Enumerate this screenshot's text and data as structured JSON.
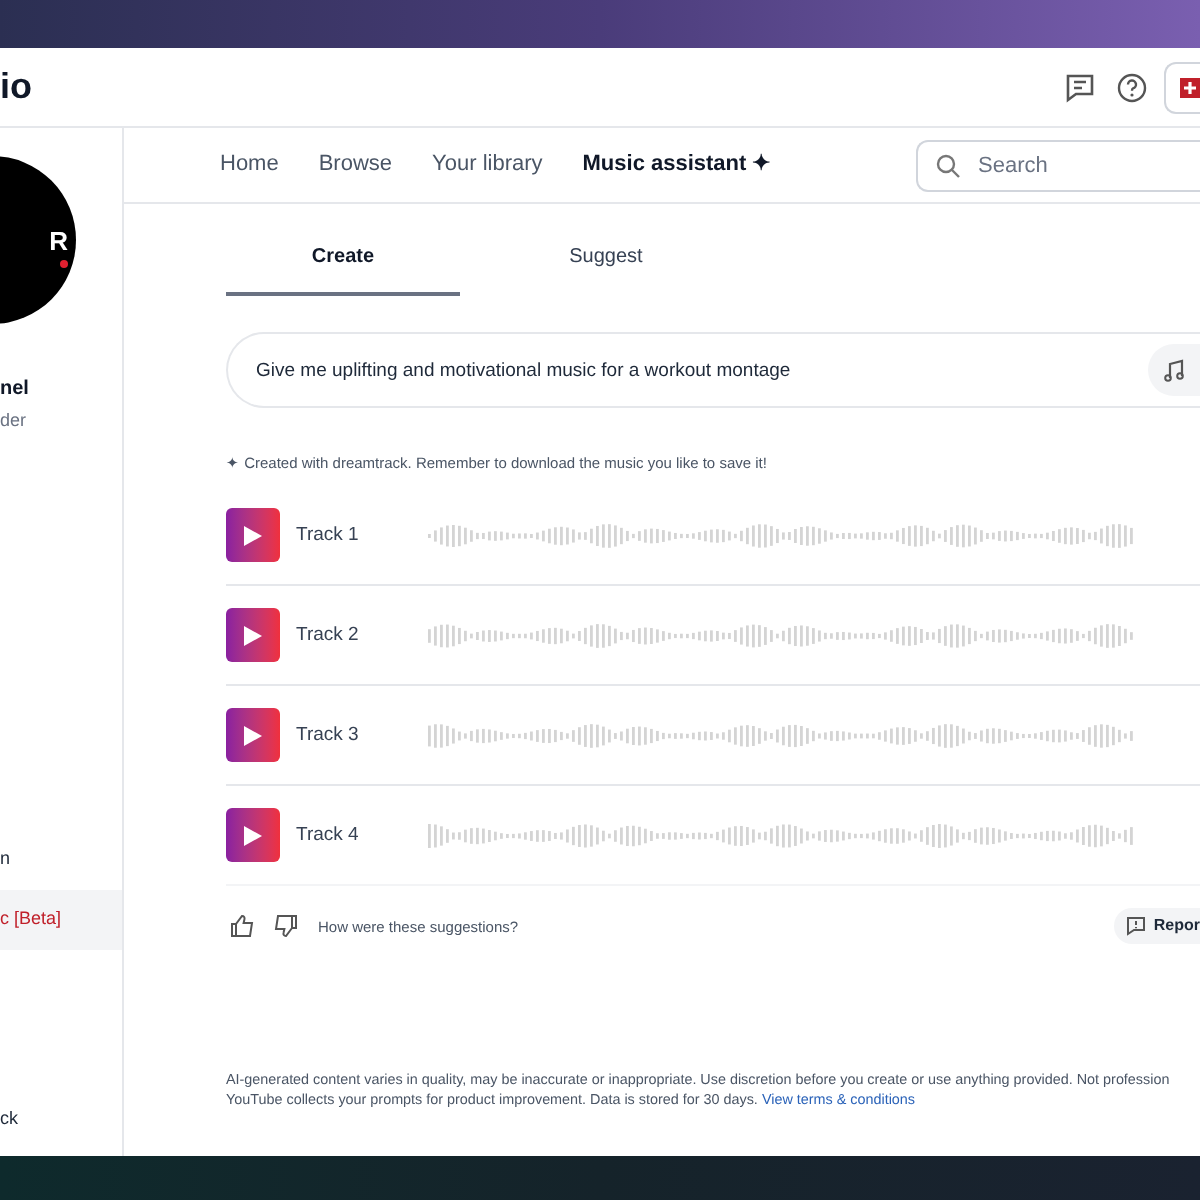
{
  "header": {
    "logo_text": "io"
  },
  "channel": {
    "avatar_text": "R",
    "name": "nel",
    "role": "der"
  },
  "sidebar": {
    "items": [
      {
        "label": "n",
        "selected": false
      },
      {
        "label": "c [Beta]",
        "selected": true
      }
    ],
    "footer": "ck"
  },
  "nav": {
    "tabs": [
      {
        "label": "Home",
        "selected": false
      },
      {
        "label": "Browse",
        "selected": false
      },
      {
        "label": "Your library",
        "selected": false
      },
      {
        "label": "Music assistant ✦",
        "selected": true
      }
    ],
    "search": {
      "placeholder": "Search"
    }
  },
  "mode_tabs": [
    {
      "label": "Create",
      "selected": true
    },
    {
      "label": "Suggest",
      "selected": false
    }
  ],
  "prompt": {
    "value": "Give me uplifting and motivational music for a workout montage"
  },
  "note": "✦ Created with dreamtrack. Remember to download the music you like to save it!",
  "tracks": [
    {
      "title": "Track 1"
    },
    {
      "title": "Track 2"
    },
    {
      "title": "Track 3"
    },
    {
      "title": "Track 4"
    }
  ],
  "feedback": {
    "question": "How were these suggestions?",
    "report": "Repor"
  },
  "disclaimer": {
    "text": "AI-generated content varies in quality, may be inaccurate or inappropriate. Use discretion before you create or use anything provided. Not profession",
    "text2": "YouTube collects your prompts for product improvement. Data is stored for 30 days.",
    "link": "View terms & conditions"
  }
}
